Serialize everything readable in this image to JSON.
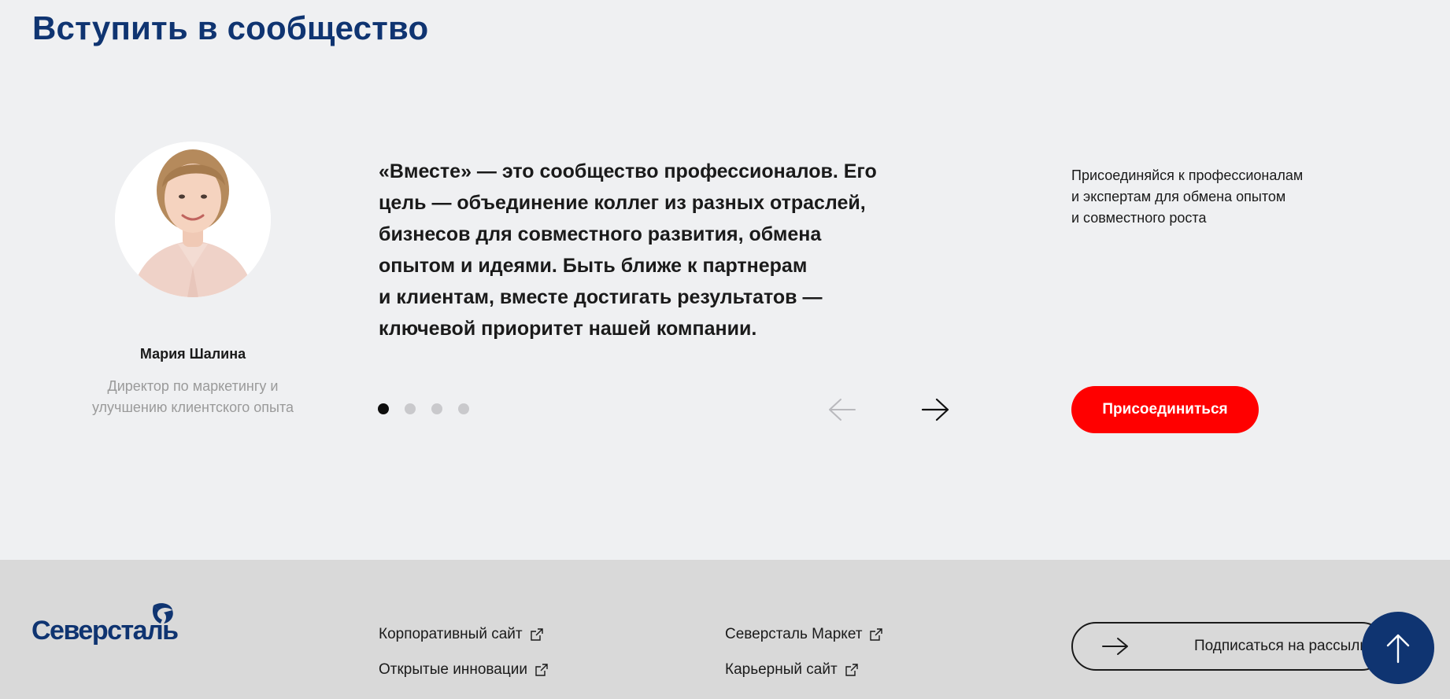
{
  "section": {
    "title": "Вступить в сообщество"
  },
  "testimonial": {
    "name": "Мария Шалина",
    "role": "Директор по маркетингу и\nулучшению клиентского опыта",
    "quote": "«Вместе» — это сообщество профессионалов. Его\nцель — объединение коллег из разных отраслей,\nбизнесов для совместного развития, обмена\nопытом и идеями. Быть ближе к партнерам\nи клиентам, вместе достигать результатов —\nключевой приоритет нашей компании.",
    "slides_total": 4,
    "slide_active": 1
  },
  "join": {
    "description": "Присоединяйся к профессионалам\nи экспертам для обмена опытом\nи совместного роста",
    "button_label": "Присоединиться"
  },
  "footer": {
    "logo_text": "Северсталь",
    "links_col1": [
      {
        "label": "Корпоративный сайт"
      },
      {
        "label": "Открытые инновации"
      }
    ],
    "links_col2": [
      {
        "label": "Северсталь Маркет"
      },
      {
        "label": "Карьерный сайт"
      }
    ],
    "subscribe_label": "Подписаться на рассылку"
  },
  "colors": {
    "brand_blue": "#0f3471",
    "accent_red": "#ff0000",
    "page_bg": "#eff0f2",
    "footer_bg": "#d9d9d9"
  },
  "icons": {
    "prev": "arrow-left-icon",
    "next": "arrow-right-icon",
    "external": "external-link-icon",
    "scroll_top": "arrow-up-icon"
  }
}
